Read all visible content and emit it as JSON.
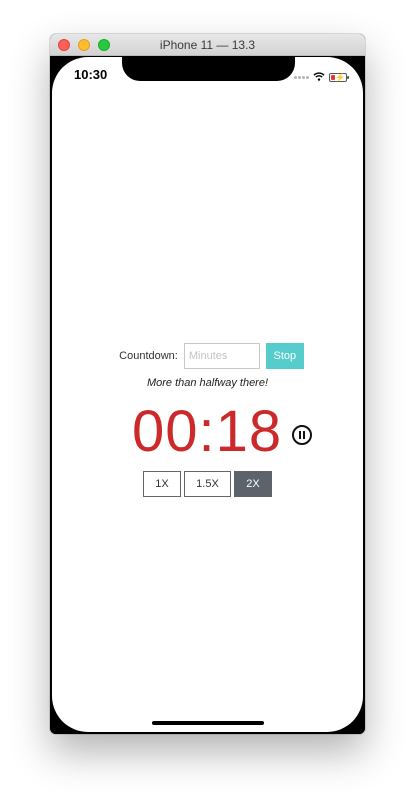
{
  "window": {
    "title": "iPhone 11 — 13.3"
  },
  "status_bar": {
    "time": "10:30",
    "icons": [
      "signal-dots-icon",
      "wifi-icon",
      "battery-charging-icon"
    ],
    "battery_level": 0.2
  },
  "countdown": {
    "label": "Countdown:",
    "input_placeholder": "Minutes",
    "input_value": "",
    "stop_label": "Stop"
  },
  "message": "More than halfway there!",
  "timer": {
    "display": "00:18",
    "pause_icon": "pause-circle-icon"
  },
  "speed": {
    "options": [
      {
        "label": "1X",
        "active": false
      },
      {
        "label": "1.5X",
        "active": false
      },
      {
        "label": "2X",
        "active": true
      }
    ]
  },
  "colors": {
    "accent": "#56cccc",
    "timer": "#cc2a2a",
    "active_speed": "#5c636a"
  }
}
